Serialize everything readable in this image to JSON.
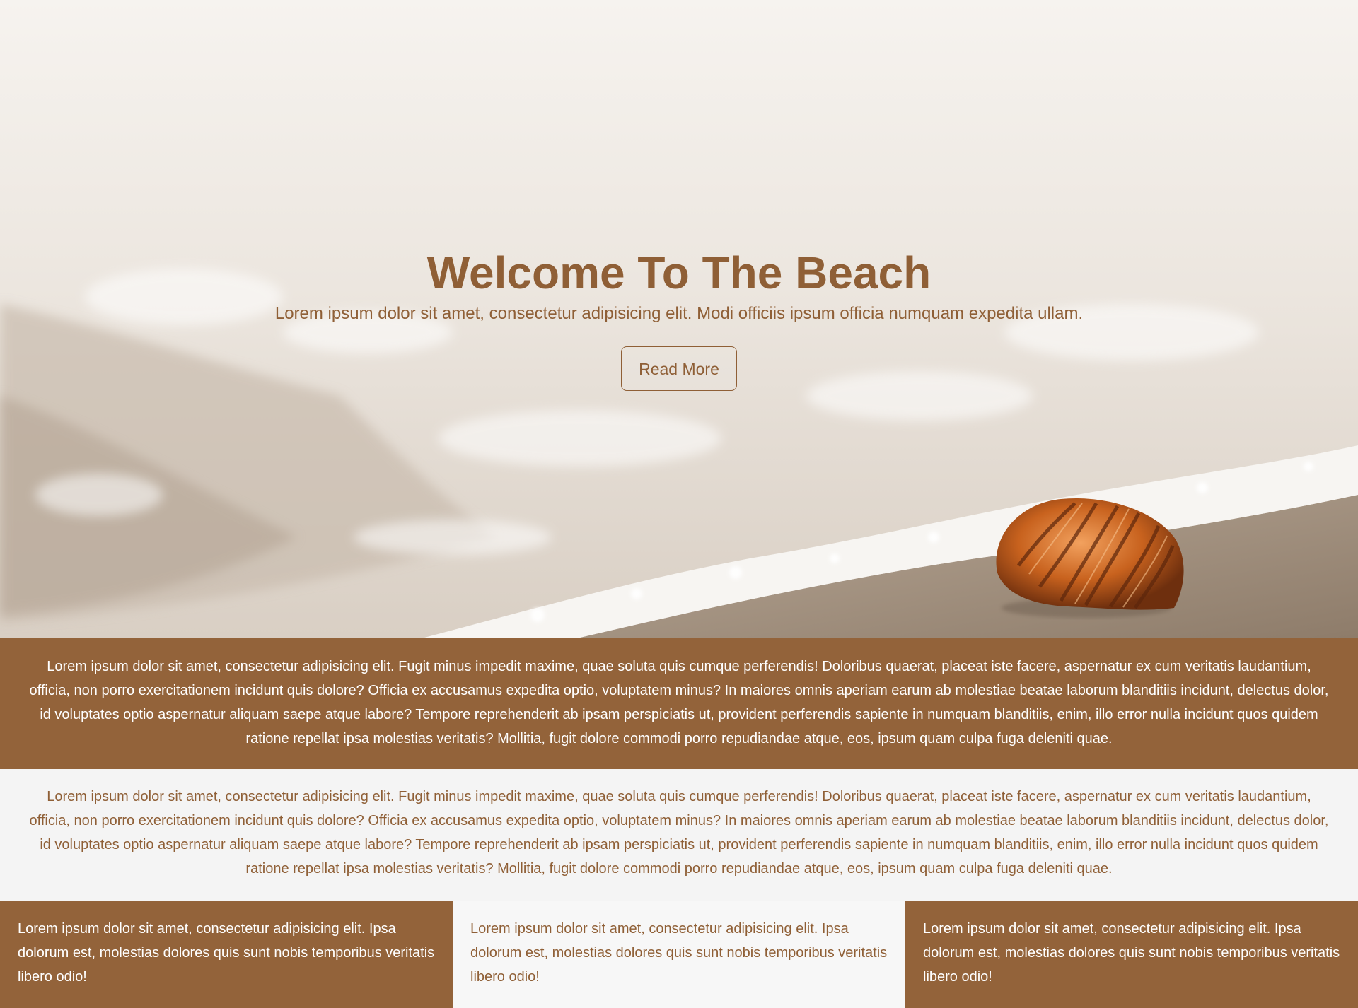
{
  "hero": {
    "title": "Welcome To The Beach",
    "subtitle": "Lorem ipsum dolor sit amet, consectetur adipisicing elit. Modi officiis ipsum officia numquam expedita ullam.",
    "button_label": "Read More"
  },
  "band_dark": {
    "text": "Lorem ipsum dolor sit amet, consectetur adipisicing elit. Fugit minus impedit maxime, quae soluta quis cumque perferendis! Doloribus quaerat, placeat iste facere, aspernatur ex cum veritatis laudantium, officia, non porro exercitationem incidunt quis dolore? Officia ex accusamus expedita optio, voluptatem minus? In maiores omnis aperiam earum ab molestiae beatae laborum blanditiis incidunt, delectus dolor, id voluptates optio aspernatur aliquam saepe atque labore? Tempore reprehenderit ab ipsam perspiciatis ut, provident perferendis sapiente in numquam blanditiis, enim, illo error nulla incidunt quos quidem ratione repellat ipsa molestias veritatis? Mollitia, fugit dolore commodi porro repudiandae atque, eos, ipsum quam culpa fuga deleniti quae."
  },
  "band_light": {
    "text": "Lorem ipsum dolor sit amet, consectetur adipisicing elit. Fugit minus impedit maxime, quae soluta quis cumque perferendis! Doloribus quaerat, placeat iste facere, aspernatur ex cum veritatis laudantium, officia, non porro exercitationem incidunt quis dolore? Officia ex accusamus expedita optio, voluptatem minus? In maiores omnis aperiam earum ab molestiae beatae laborum blanditiis incidunt, delectus dolor, id voluptates optio aspernatur aliquam saepe atque labore? Tempore reprehenderit ab ipsam perspiciatis ut, provident perferendis sapiente in numquam blanditiis, enim, illo error nulla incidunt quos quidem ratione repellat ipsa molestias veritatis? Mollitia, fugit dolore commodi porro repudiandae atque, eos, ipsum quam culpa fuga deleniti quae."
  },
  "columns": [
    {
      "text": "Lorem ipsum dolor sit amet, consectetur adipisicing elit. Ipsa dolorum est, molestias dolores quis sunt nobis temporibus veritatis libero odio!"
    },
    {
      "text": "Lorem ipsum dolor sit amet, consectetur adipisicing elit. Ipsa dolorum est, molestias dolores quis sunt nobis temporibus veritatis libero odio!"
    },
    {
      "text": "Lorem ipsum dolor sit amet, consectetur adipisicing elit. Ipsa dolorum est, molestias dolores quis sunt nobis temporibus veritatis libero odio!"
    }
  ],
  "colors": {
    "brown": "#93633a",
    "brown_text": "#8f5f36",
    "light_bg": "#f4f4f4",
    "white": "#ffffff"
  },
  "icons": {
    "hero_image": "beach-seashell-image"
  }
}
